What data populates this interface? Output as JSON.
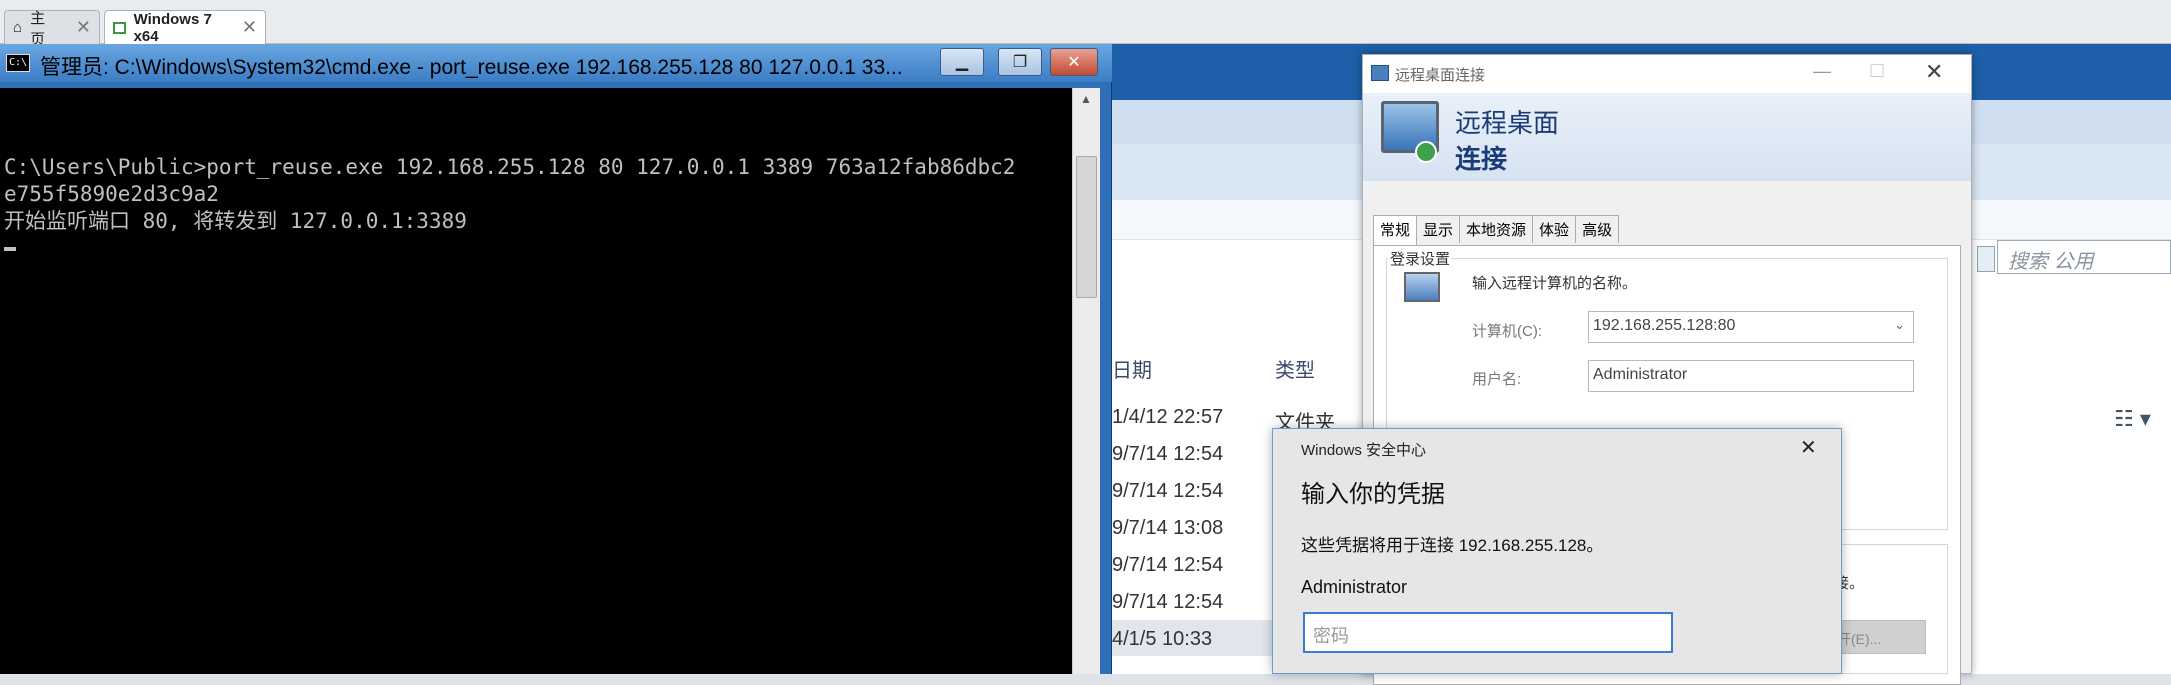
{
  "vm_tabs": [
    {
      "label": "主页",
      "icon": "home-icon"
    },
    {
      "label": "Windows 7 x64",
      "icon": "vm-icon"
    }
  ],
  "cmd": {
    "title": "管理员: C:\\Windows\\System32\\cmd.exe - port_reuse.exe  192.168.255.128 80 127.0.0.1 33...",
    "lines": [
      "C:\\Users\\Public>port_reuse.exe 192.168.255.128 80 127.0.0.1 3389 763a12fab86dbc2",
      "e755f5890e2d3c9a2",
      "开始监听端口 80, 将转发到 127.0.0.1:3389"
    ]
  },
  "explorer": {
    "search_placeholder": "搜索 公用",
    "col_date": "日期",
    "col_type": "类型",
    "rows": [
      {
        "date": "1/4/12 22:57",
        "type": "文件夹"
      },
      {
        "date": "9/7/14 12:54",
        "type": ""
      },
      {
        "date": "9/7/14 12:54",
        "type": ""
      },
      {
        "date": "9/7/14 13:08",
        "type": ""
      },
      {
        "date": "9/7/14 12:54",
        "type": ""
      },
      {
        "date": "9/7/14 12:54",
        "type": ""
      },
      {
        "date": "4/1/5 10:33",
        "type": ""
      }
    ]
  },
  "rdc": {
    "title": "远程桌面连接",
    "header_line1": "远程桌面",
    "header_line2": "连接",
    "tabs": [
      "常规",
      "显示",
      "本地资源",
      "体验",
      "高级"
    ],
    "group_title": "登录设置",
    "prompt": "输入远程计算机的名称。",
    "computer_label": "计算机(C):",
    "computer_value": "192.168.255.128:80",
    "user_label": "用户名:",
    "user_value": "Administrator",
    "partial_text": "接。",
    "open_button": "开(E)..."
  },
  "security": {
    "title": "Windows 安全中心",
    "heading": "输入你的凭据",
    "description": "这些凭据将用于连接 192.168.255.128。",
    "username": "Administrator",
    "password_placeholder": "密码"
  }
}
